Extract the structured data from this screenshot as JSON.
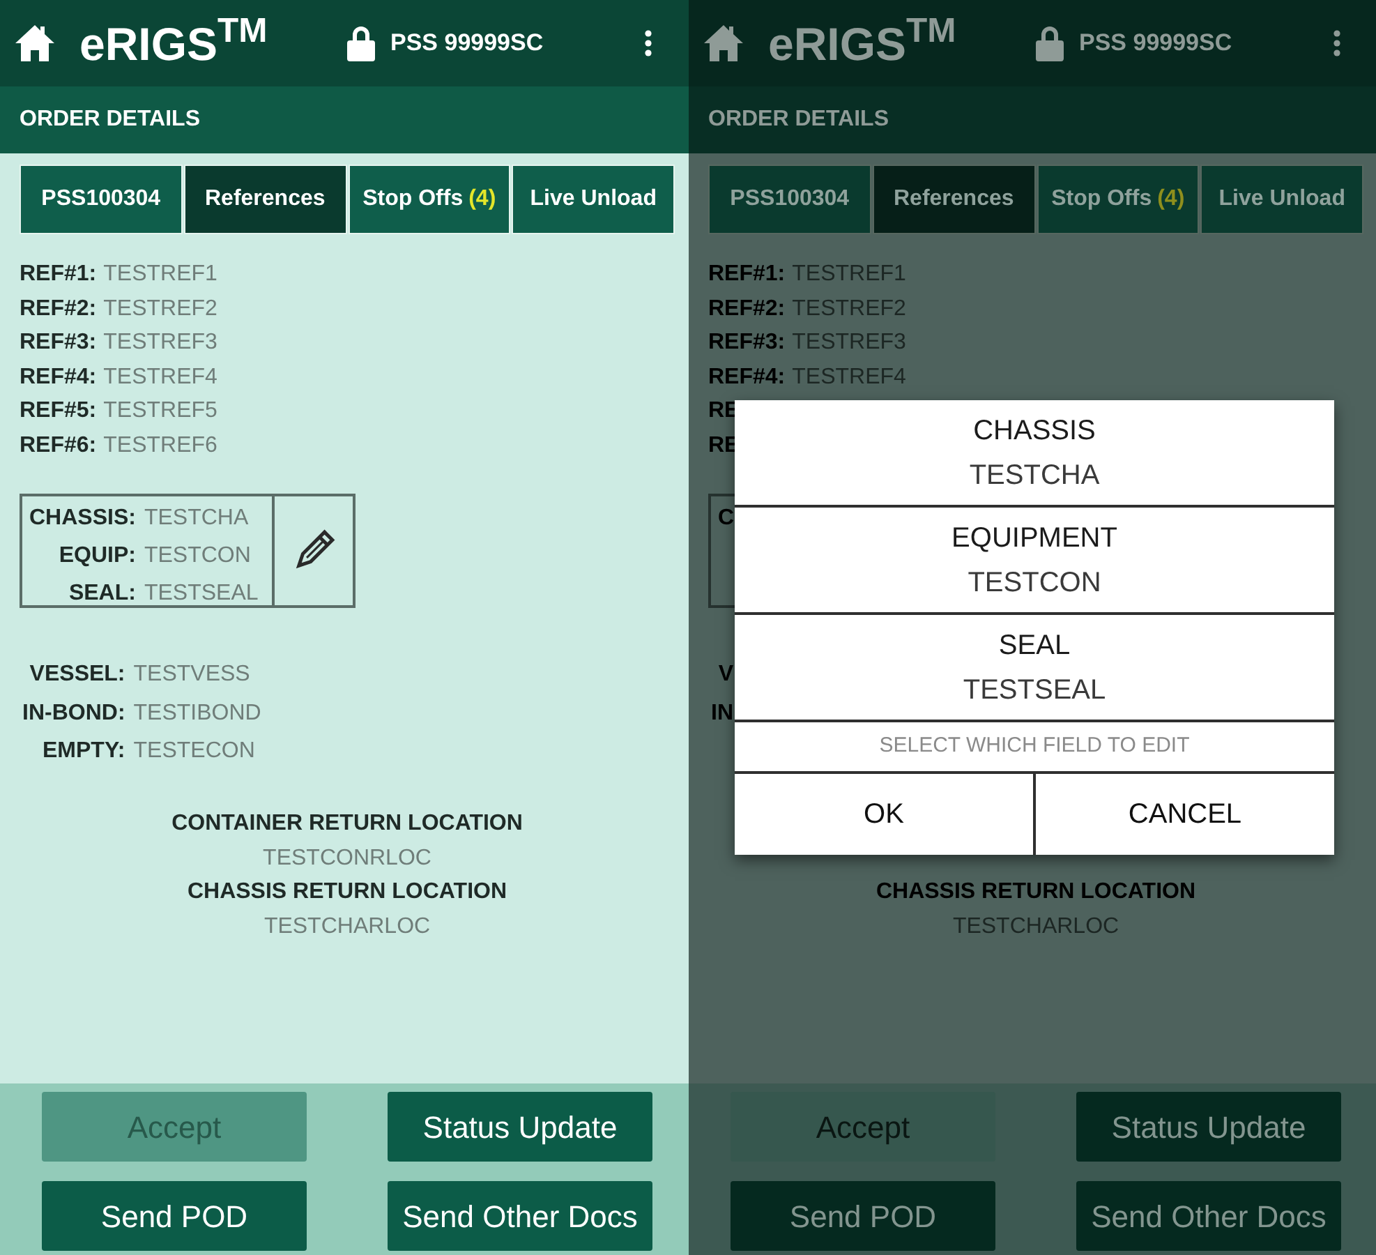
{
  "screens": [
    {
      "dimmed": false,
      "app_title": "eRIGS$^{TM}$",
      "user": "PSS 99999SC",
      "section_title": "ORDER DETAILS",
      "tabs": [
        {
          "label": "PSS100304",
          "selected": false
        },
        {
          "label": "References",
          "selected": true
        },
        {
          "label": "Stop Offs",
          "count": "(4)",
          "selected": false
        },
        {
          "label": "Live Unload",
          "selected": false
        }
      ],
      "references": [
        {
          "label": "REF#1:",
          "value": "TESTREF1"
        },
        {
          "label": "REF#2:",
          "value": "TESTREF2"
        },
        {
          "label": "REF#3:",
          "value": "TESTREF3"
        },
        {
          "label": "REF#4:",
          "value": "TESTREF4"
        },
        {
          "label": "REF#5:",
          "value": "TESTREF5"
        },
        {
          "label": "REF#6:",
          "value": "TESTREF6"
        }
      ],
      "equipment_box": {
        "edit_button": true,
        "fields": [
          {
            "label": "CHASSIS:",
            "value": "TESTCHA"
          },
          {
            "label": "EQUIP:",
            "value": "TESTCON"
          },
          {
            "label": "SEAL:",
            "value": "TESTSEAL"
          }
        ]
      },
      "details": [
        {
          "label": "VESSEL:",
          "value": "TESTVESS"
        },
        {
          "label": "IN-BOND:",
          "value": "TESTIBOND"
        },
        {
          "label": "EMPTY:",
          "value": "TESTECON"
        }
      ],
      "locations": [
        {
          "title": "CONTAINER RETURN LOCATION",
          "value": "TESTCONRLOC"
        },
        {
          "title": "CHASSIS RETURN LOCATION",
          "value": "TESTCHARLOC"
        }
      ],
      "buttons": [
        {
          "label": "Accept",
          "disabled": true
        },
        {
          "label": "Status Update",
          "disabled": false
        },
        {
          "label": "Send POD",
          "disabled": false
        },
        {
          "label": "Send Other Docs",
          "disabled": false
        }
      ]
    },
    {
      "dimmed": true,
      "app_title": "eRIGS$^{TM}$",
      "user": "PSS 99999SC",
      "section_title": "ORDER DETAILS",
      "tabs": [
        {
          "label": "PSS100304",
          "selected": false
        },
        {
          "label": "References",
          "selected": true
        },
        {
          "label": "Stop Offs",
          "count": "(4)",
          "selected": false
        },
        {
          "label": "Live Unload",
          "selected": false
        }
      ],
      "references": [
        {
          "label": "REF#1:",
          "value": "TESTREF1"
        },
        {
          "label": "REF#2:",
          "value": "TESTREF2"
        },
        {
          "label": "REF#3:",
          "value": "TESTREF3"
        },
        {
          "label": "REF#4:",
          "value": "TESTREF4"
        },
        {
          "label": "RE"
        },
        {
          "label": "RE"
        }
      ],
      "equipment_box": {
        "fields": [
          {
            "label": "C"
          }
        ]
      },
      "details": [
        {
          "label": "V"
        },
        {
          "label": "IN"
        }
      ],
      "locations": [
        {
          "title": "CHASSIS RETURN LOCATION",
          "value": "TESTCHARLOC"
        }
      ],
      "buttons": [
        {
          "label": "Accept",
          "disabled": true
        },
        {
          "label": "Status Update",
          "disabled": false
        },
        {
          "label": "Send POD",
          "disabled": false
        },
        {
          "label": "Send Other Docs",
          "disabled": false
        }
      ],
      "dialog": {
        "options": [
          {
            "title": "CHASSIS",
            "value": "TESTCHA"
          },
          {
            "title": "EQUIPMENT",
            "value": "TESTCON"
          },
          {
            "title": "SEAL",
            "value": "TESTSEAL"
          }
        ],
        "hint": "SELECT WHICH FIELD TO EDIT",
        "buttons": [
          "OK",
          "CANCEL"
        ]
      }
    }
  ]
}
